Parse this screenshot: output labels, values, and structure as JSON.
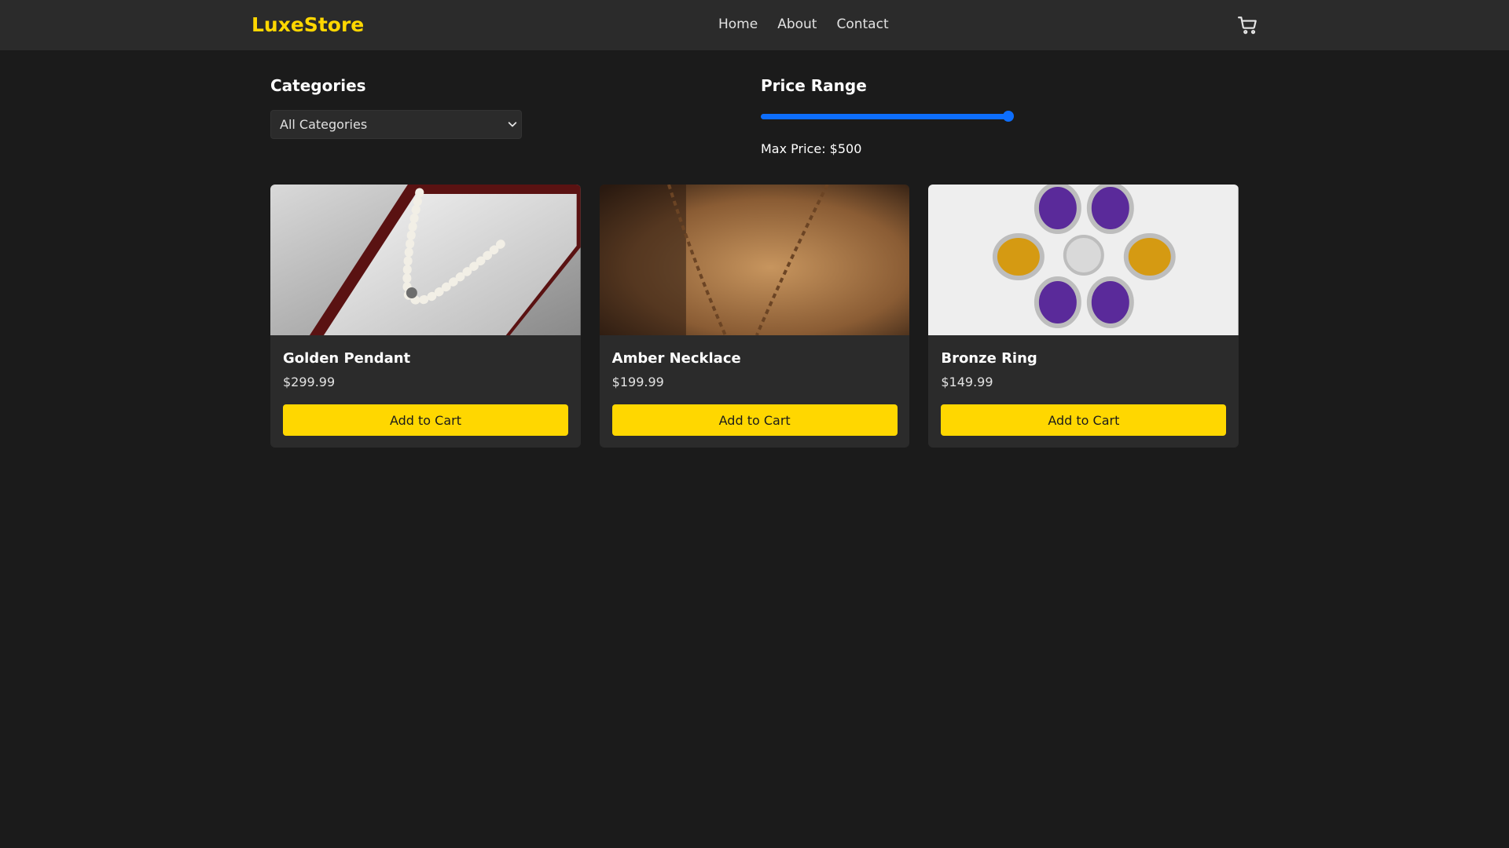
{
  "brand": {
    "name": "LuxeStore",
    "color": "#ffd700"
  },
  "nav": {
    "links": [
      "Home",
      "About",
      "Contact"
    ]
  },
  "cart": {
    "icon": "cart-icon"
  },
  "filters": {
    "categories": {
      "title": "Categories",
      "selected": "All Categories",
      "icon": "chevron-down-icon"
    },
    "price": {
      "title": "Price Range",
      "max_label": "Max Price: $500",
      "slider_value_fraction": 1.0,
      "accent": "#0d6efd"
    }
  },
  "products": [
    {
      "name": "Golden Pendant",
      "price": "$299.99",
      "button": "Add to Cart",
      "image": "pearl-necklace-in-box-image"
    },
    {
      "name": "Amber Necklace",
      "price": "$199.99",
      "button": "Add to Cart",
      "image": "chain-necklace-image"
    },
    {
      "name": "Bronze Ring",
      "price": "$149.99",
      "button": "Add to Cart",
      "image": "gemstone-flower-ring-image"
    }
  ],
  "colors": {
    "background": "#1b1b1b",
    "surface": "#2b2b2b",
    "button": "#ffd700"
  }
}
